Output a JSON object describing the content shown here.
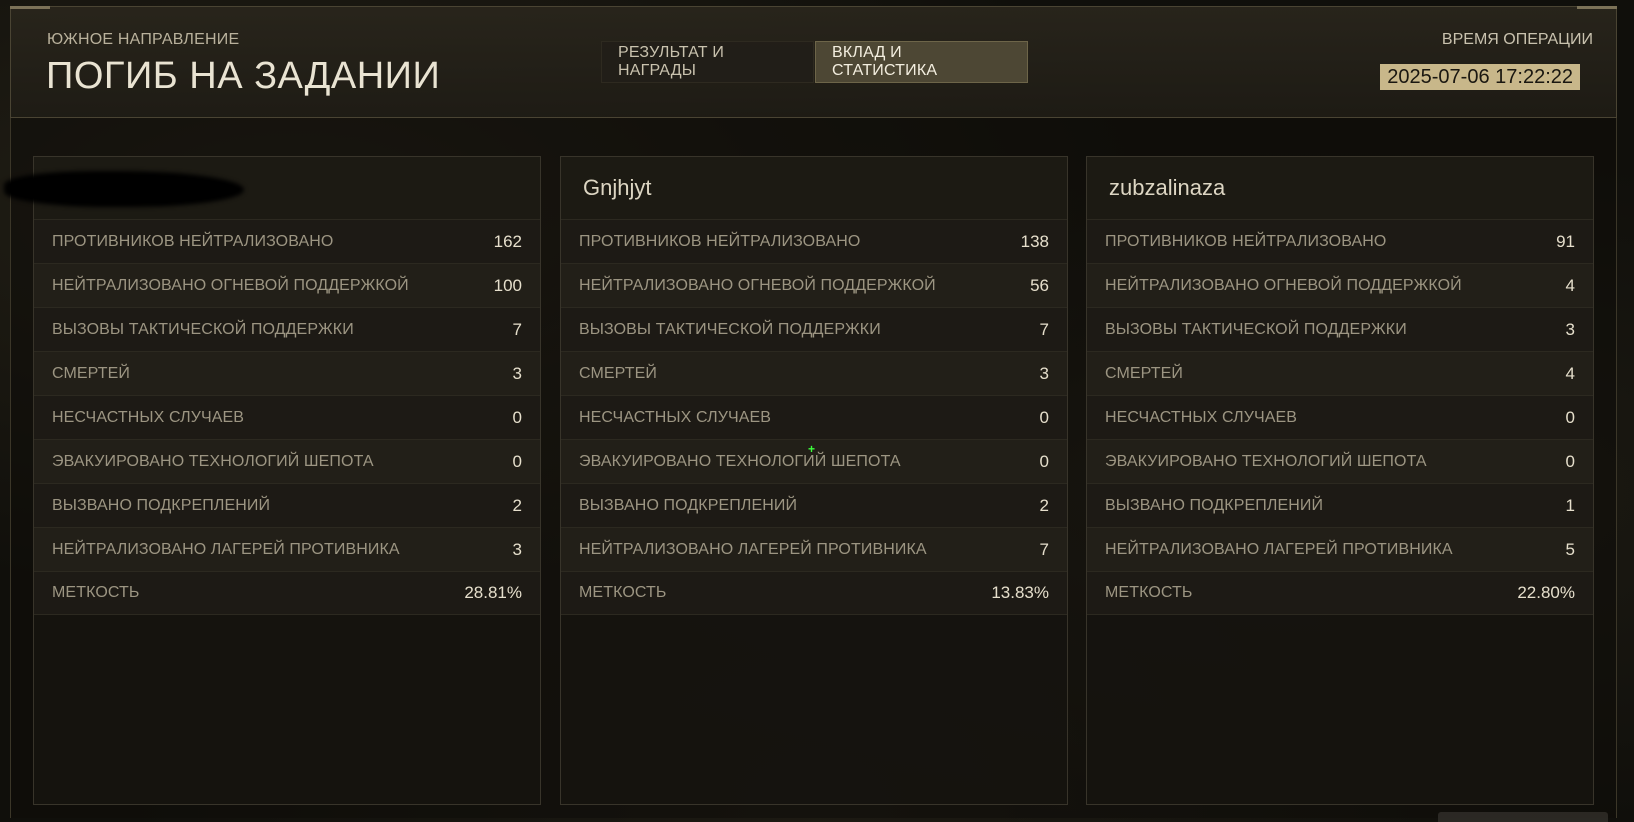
{
  "header": {
    "region": "ЮЖНОЕ НАПРАВЛЕНИЕ",
    "status": "ПОГИБ НА ЗАДАНИИ",
    "tabs": [
      "РЕЗУЛЬТАТ И НАГРАДЫ",
      "ВКЛАД И СТАТИСТИКА"
    ],
    "active_tab": "ВКЛАД И СТАТИСТИКА",
    "time_label": "ВРЕМЯ ОПЕРАЦИИ",
    "time_value": "2025-07-06 17:22:22"
  },
  "players": [
    {
      "name": "",
      "name_redacted": true,
      "stats": [
        {
          "label": "ПРОТИВНИКОВ НЕЙТРАЛИЗОВАНО",
          "value": "162"
        },
        {
          "label": "НЕЙТРАЛИЗОВАНО ОГНЕВОЙ ПОДДЕРЖКОЙ",
          "value": "100"
        },
        {
          "label": "ВЫЗОВЫ ТАКТИЧЕСКОЙ ПОДДЕРЖКИ",
          "value": "7"
        },
        {
          "label": "СМЕРТЕЙ",
          "value": "3"
        },
        {
          "label": "НЕСЧАСТНЫХ СЛУЧАЕВ",
          "value": "0"
        },
        {
          "label": "ЭВАКУИРОВАНО ТЕХНОЛОГИЙ ШЕПОТА",
          "value": "0"
        },
        {
          "label": "ВЫЗВАНО ПОДКРЕПЛЕНИЙ",
          "value": "2"
        },
        {
          "label": "НЕЙТРАЛИЗОВАНО ЛАГЕРЕЙ ПРОТИВНИКА",
          "value": "3"
        },
        {
          "label": "МЕТКОСТЬ",
          "value": "28.81%"
        }
      ]
    },
    {
      "name": "Gnjhjyt",
      "name_redacted": false,
      "stats": [
        {
          "label": "ПРОТИВНИКОВ НЕЙТРАЛИЗОВАНО",
          "value": "138"
        },
        {
          "label": "НЕЙТРАЛИЗОВАНО ОГНЕВОЙ ПОДДЕРЖКОЙ",
          "value": "56"
        },
        {
          "label": "ВЫЗОВЫ ТАКТИЧЕСКОЙ ПОДДЕРЖКИ",
          "value": "7"
        },
        {
          "label": "СМЕРТЕЙ",
          "value": "3"
        },
        {
          "label": "НЕСЧАСТНЫХ СЛУЧАЕВ",
          "value": "0"
        },
        {
          "label": "ЭВАКУИРОВАНО ТЕХНОЛОГИЙ ШЕПОТА",
          "value": "0"
        },
        {
          "label": "ВЫЗВАНО ПОДКРЕПЛЕНИЙ",
          "value": "2"
        },
        {
          "label": "НЕЙТРАЛИЗОВАНО ЛАГЕРЕЙ ПРОТИВНИКА",
          "value": "7"
        },
        {
          "label": "МЕТКОСТЬ",
          "value": "13.83%"
        }
      ]
    },
    {
      "name": "zubzalinaza",
      "name_redacted": false,
      "stats": [
        {
          "label": "ПРОТИВНИКОВ НЕЙТРАЛИЗОВАНО",
          "value": "91"
        },
        {
          "label": "НЕЙТРАЛИЗОВАНО ОГНЕВОЙ ПОДДЕРЖКОЙ",
          "value": "4"
        },
        {
          "label": "ВЫЗОВЫ ТАКТИЧЕСКОЙ ПОДДЕРЖКИ",
          "value": "3"
        },
        {
          "label": "СМЕРТЕЙ",
          "value": "4"
        },
        {
          "label": "НЕСЧАСТНЫХ СЛУЧАЕВ",
          "value": "0"
        },
        {
          "label": "ЭВАКУИРОВАНО ТЕХНОЛОГИЙ ШЕПОТА",
          "value": "0"
        },
        {
          "label": "ВЫЗВАНО ПОДКРЕПЛЕНИЙ",
          "value": "1"
        },
        {
          "label": "НЕЙТРАЛИЗОВАНО ЛАГЕРЕЙ ПРОТИВНИКА",
          "value": "5"
        },
        {
          "label": "МЕТКОСТЬ",
          "value": "22.80%"
        }
      ]
    }
  ],
  "colors": {
    "accent_gold": "#c8b78a",
    "active_tab_bg": "#4d4734",
    "cursor": "#3cff3c"
  },
  "icons": {
    "cursor": "crosshair-cursor-icon"
  }
}
